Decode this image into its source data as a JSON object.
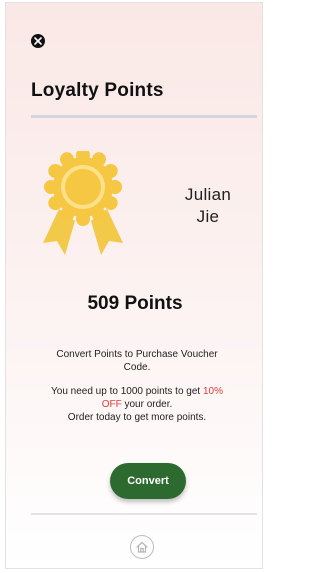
{
  "header": {
    "close_icon": "close-icon",
    "title": "Loyalty Points"
  },
  "profile": {
    "badge_icon": "award-ribbon-icon",
    "first_name": "Julian",
    "last_name": "Jie"
  },
  "points": {
    "value": "509 Points"
  },
  "info": {
    "line1": "Convert Points to Purchase Voucher Code.",
    "line2_prefix": "You need up to 1000 points to get ",
    "line2_highlight": "10% OFF",
    "line2_suffix": " your order.",
    "line3": "Order today to get more points."
  },
  "actions": {
    "convert_label": "Convert"
  },
  "nav": {
    "home_icon": "home-icon"
  },
  "colors": {
    "accent": "#2c6a2f",
    "highlight": "#e33b3b",
    "badge": "#f5c742"
  }
}
